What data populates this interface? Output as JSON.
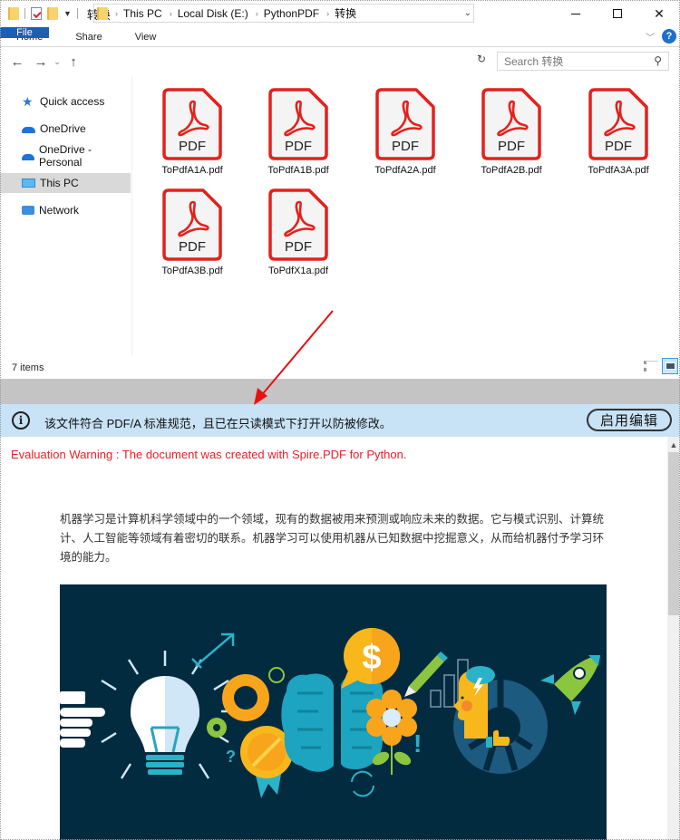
{
  "window": {
    "title": "转换",
    "controls": {
      "minimize": "minimize",
      "maximize": "maximize",
      "close": "✕"
    }
  },
  "ribbon": {
    "tabs": [
      {
        "label": "File",
        "active": true
      },
      {
        "label": "Home"
      },
      {
        "label": "Share"
      },
      {
        "label": "View"
      }
    ],
    "help": "?"
  },
  "address": {
    "crumbs": [
      "This PC",
      "Local Disk (E:)",
      "PythonPDF",
      "转换"
    ],
    "search_placeholder": "Search 转换"
  },
  "sidebar": {
    "items": [
      {
        "label": "Quick access",
        "icon": "star-icon"
      },
      {
        "label": "OneDrive",
        "icon": "cloud-icon"
      },
      {
        "label": "OneDrive - Personal",
        "icon": "cloud-icon"
      },
      {
        "label": "This PC",
        "icon": "computer-icon",
        "selected": true
      },
      {
        "label": "Network",
        "icon": "network-icon"
      }
    ]
  },
  "files": [
    {
      "name": "ToPdfA1A.pdf",
      "type": "PDF"
    },
    {
      "name": "ToPdfA1B.pdf",
      "type": "PDF"
    },
    {
      "name": "ToPdfA2A.pdf",
      "type": "PDF"
    },
    {
      "name": "ToPdfA2B.pdf",
      "type": "PDF"
    },
    {
      "name": "ToPdfA3A.pdf",
      "type": "PDF"
    },
    {
      "name": "ToPdfA3B.pdf",
      "type": "PDF"
    },
    {
      "name": "ToPdfX1a.pdf",
      "type": "PDF"
    }
  ],
  "status": {
    "item_count": "7 items"
  },
  "colors": {
    "accent": "#1a5fb4",
    "pdf_red": "#e3211c",
    "info_bar": "#c8e2f6",
    "warning_red": "#e8202a",
    "illustration_bg": "#032b40"
  },
  "infobar": {
    "message": "该文件符合 PDF/A 标准规范，且已在只读模式下打开以防被修改。",
    "button": "启用编辑"
  },
  "document": {
    "warning": "Evaluation Warning : The document was created with Spire.PDF for Python.",
    "paragraph": "机器学习是计算机科学领域中的一个领域，现有的数据被用来预测或响应未来的数据。它与模式识别、计算统计、人工智能等领域有着密切的联系。机器学习可以使用机器从已知数据中挖掘意义，从而给机器付予学习环境的能力。",
    "illustration_text": {
      "dollar": "$",
      "question": "?",
      "exclaim": "!"
    }
  }
}
